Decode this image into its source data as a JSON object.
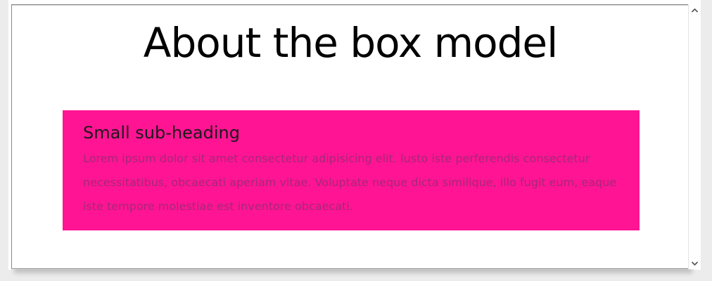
{
  "page": {
    "title": "About the box model"
  },
  "box": {
    "heading": "Small sub-heading",
    "paragraph": "Lorem ipsum dolor sit amet consectetur adipisicing elit. Iusto iste perferendis consectetur necessitatibus, obcaecati aperiam vitae. Voluptate neque dicta similique, illo fugit eum, eaque iste tempore molestiae est inventore obcaecati."
  },
  "colors": {
    "box_background": "#ff1493",
    "paragraph_text": "#a6277a"
  },
  "icons": {
    "scroll_up": "chevron-up-icon",
    "scroll_down": "chevron-down-icon"
  }
}
